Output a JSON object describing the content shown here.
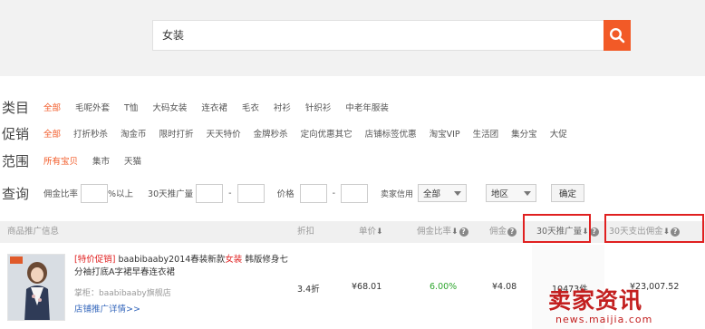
{
  "search": {
    "value": "女装"
  },
  "filters": {
    "category": {
      "label": "类目",
      "options": [
        "全部",
        "毛呢外套",
        "T恤",
        "大码女装",
        "连衣裙",
        "毛衣",
        "衬衫",
        "针织衫",
        "中老年服装"
      ],
      "active": 0
    },
    "promotion": {
      "label": "促销",
      "options": [
        "全部",
        "打折秒杀",
        "淘金币",
        "限时打折",
        "天天特价",
        "金牌秒杀",
        "定向优惠其它",
        "店铺标签优惠",
        "淘宝VIP",
        "生活团",
        "集分宝",
        "大促"
      ],
      "active": 0
    },
    "scope": {
      "label": "范围",
      "options": [
        "所有宝贝",
        "集市",
        "天猫"
      ],
      "active": 0
    }
  },
  "query": {
    "label": "查询",
    "commission_rate": "佣金比率",
    "pct_above": "%以上",
    "promo_volume": "30天推广量",
    "dash": "-",
    "price": "价格",
    "seller_credit": "卖家信用",
    "credit_value": "全部",
    "region": "地区",
    "confirm": "确定"
  },
  "table": {
    "headers": {
      "info": "商品推广信息",
      "discount": "折扣",
      "unit_price": "单价",
      "commission_rate": "佣金比率",
      "commission": "佣金",
      "promo_30d": "30天推广量",
      "spend_30d": "30天支出佣金"
    },
    "row": {
      "tag": "[特价促销]",
      "title_a": " baabibaaby2014春装新款",
      "title_red": "女装",
      "title_b": " 韩版修身七分袖打底A字裙早春连衣裙",
      "shop": "掌柜：baabibaaby旗舰店",
      "promo_link": "店铺推广详情>>",
      "discount": "3.4折",
      "unit_price": "¥68.01",
      "commission_rate": "6.00%",
      "commission": "¥4.08",
      "promo_30d": "10473件",
      "spend_30d": "¥23,007.52"
    }
  },
  "watermark": {
    "main": "卖家资讯",
    "sub": "news.maijia.com"
  },
  "colors": {
    "accent": "#f25a27",
    "highlight": "#e02020",
    "rate": "#2ea52e",
    "link": "#3366bb"
  }
}
